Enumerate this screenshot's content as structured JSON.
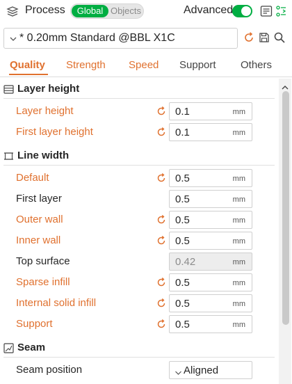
{
  "header": {
    "title": "Process",
    "segment": {
      "global": "Global",
      "objects": "Objects",
      "selected": "Global"
    },
    "advanced_label": "Advanced",
    "advanced_on": true
  },
  "preset": {
    "name": "* 0.20mm Standard @BBL X1C"
  },
  "tabs": [
    {
      "label": "Quality",
      "active": true
    },
    {
      "label": "Strength"
    },
    {
      "label": "Speed"
    },
    {
      "label": "Support"
    },
    {
      "label": "Others"
    }
  ],
  "sections": {
    "layer_height": {
      "title": "Layer height",
      "rows": [
        {
          "label": "Layer height",
          "value": "0.1",
          "unit": "mm",
          "modified": true
        },
        {
          "label": "First layer height",
          "value": "0.1",
          "unit": "mm",
          "modified": true
        }
      ]
    },
    "line_width": {
      "title": "Line width",
      "rows": [
        {
          "label": "Default",
          "value": "0.5",
          "unit": "mm",
          "modified": true
        },
        {
          "label": "First layer",
          "value": "0.5",
          "unit": "mm",
          "modified": false
        },
        {
          "label": "Outer wall",
          "value": "0.5",
          "unit": "mm",
          "modified": true
        },
        {
          "label": "Inner wall",
          "value": "0.5",
          "unit": "mm",
          "modified": true
        },
        {
          "label": "Top surface",
          "value": "0.42",
          "unit": "mm",
          "modified": false,
          "disabled": true
        },
        {
          "label": "Sparse infill",
          "value": "0.5",
          "unit": "mm",
          "modified": true
        },
        {
          "label": "Internal solid infill",
          "value": "0.5",
          "unit": "mm",
          "modified": true
        },
        {
          "label": "Support",
          "value": "0.5",
          "unit": "mm",
          "modified": true
        }
      ]
    },
    "seam": {
      "title": "Seam",
      "rows": [
        {
          "label": "Seam position",
          "value": "Aligned"
        }
      ]
    }
  },
  "colors": {
    "accent": "#00ae42",
    "modified": "#e0712f"
  },
  "icons": {
    "process": "layers-icon",
    "list": "list-icon",
    "compare": "compare-icon",
    "save": "save-icon",
    "search": "search-icon",
    "reset": "undo-arrow-icon"
  }
}
